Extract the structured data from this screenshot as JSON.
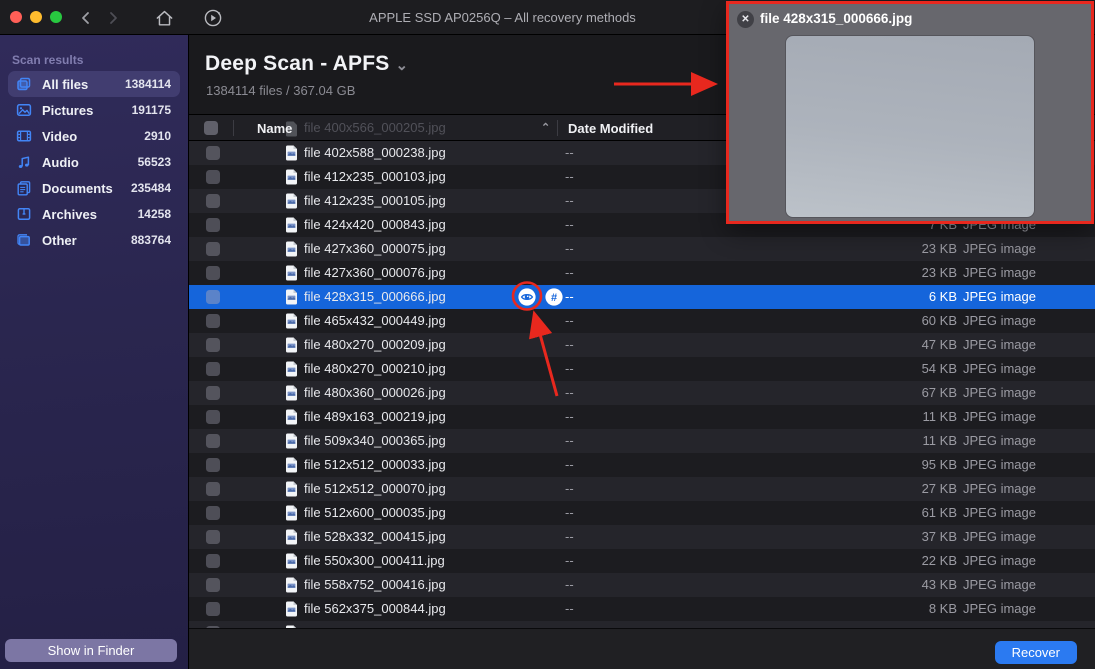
{
  "window": {
    "title": "APPLE SSD AP0256Q – All recovery methods"
  },
  "toolbar": {
    "buttons": [
      "close",
      "minimize",
      "zoom",
      "back",
      "forward",
      "home",
      "rescan"
    ]
  },
  "sidebar": {
    "section_label": "Scan results",
    "items": [
      {
        "icon": "all-files-icon",
        "label": "All files",
        "count": "1384114",
        "selected": true
      },
      {
        "icon": "pictures-icon",
        "label": "Pictures",
        "count": "191175",
        "selected": false
      },
      {
        "icon": "video-icon",
        "label": "Video",
        "count": "2910",
        "selected": false
      },
      {
        "icon": "audio-icon",
        "label": "Audio",
        "count": "56523",
        "selected": false
      },
      {
        "icon": "documents-icon",
        "label": "Documents",
        "count": "235484",
        "selected": false
      },
      {
        "icon": "archives-icon",
        "label": "Archives",
        "count": "14258",
        "selected": false
      },
      {
        "icon": "other-icon",
        "label": "Other",
        "count": "883764",
        "selected": false
      }
    ],
    "show_in_finder_label": "Show in Finder"
  },
  "header": {
    "title": "Deep Scan - APFS",
    "chevron": "⌄",
    "subtitle": "1384114 files / 367.04 GB"
  },
  "table": {
    "columns": {
      "name": "Name",
      "date_modified": "Date Modified",
      "sort_indicator": "⌃"
    },
    "ghost_row": {
      "name": "file 400x566_000205.jpg"
    },
    "clipped_row": true,
    "rows": [
      {
        "name": "file 402x588_000238.jpg",
        "date": "--",
        "size": "",
        "type": "",
        "selected": false
      },
      {
        "name": "file 412x235_000103.jpg",
        "date": "--",
        "size": "",
        "type": "",
        "selected": false
      },
      {
        "name": "file 412x235_000105.jpg",
        "date": "--",
        "size": "",
        "type": "",
        "selected": false
      },
      {
        "name": "file 424x420_000843.jpg",
        "date": "--",
        "size": "7 KB",
        "type": "JPEG image",
        "selected": false
      },
      {
        "name": "file 427x360_000075.jpg",
        "date": "--",
        "size": "23 KB",
        "type": "JPEG image",
        "selected": false
      },
      {
        "name": "file 427x360_000076.jpg",
        "date": "--",
        "size": "23 KB",
        "type": "JPEG image",
        "selected": false
      },
      {
        "name": "file 428x315_000666.jpg",
        "date": "--",
        "size": "6 KB",
        "type": "JPEG image",
        "selected": true
      },
      {
        "name": "file 465x432_000449.jpg",
        "date": "--",
        "size": "60 KB",
        "type": "JPEG image",
        "selected": false
      },
      {
        "name": "file 480x270_000209.jpg",
        "date": "--",
        "size": "47 KB",
        "type": "JPEG image",
        "selected": false
      },
      {
        "name": "file 480x270_000210.jpg",
        "date": "--",
        "size": "54 KB",
        "type": "JPEG image",
        "selected": false
      },
      {
        "name": "file 480x360_000026.jpg",
        "date": "--",
        "size": "67 KB",
        "type": "JPEG image",
        "selected": false
      },
      {
        "name": "file 489x163_000219.jpg",
        "date": "--",
        "size": "11 KB",
        "type": "JPEG image",
        "selected": false
      },
      {
        "name": "file 509x340_000365.jpg",
        "date": "--",
        "size": "11 KB",
        "type": "JPEG image",
        "selected": false
      },
      {
        "name": "file 512x512_000033.jpg",
        "date": "--",
        "size": "95 KB",
        "type": "JPEG image",
        "selected": false
      },
      {
        "name": "file 512x512_000070.jpg",
        "date": "--",
        "size": "27 KB",
        "type": "JPEG image",
        "selected": false
      },
      {
        "name": "file 512x600_000035.jpg",
        "date": "--",
        "size": "61 KB",
        "type": "JPEG image",
        "selected": false
      },
      {
        "name": "file 528x332_000415.jpg",
        "date": "--",
        "size": "37 KB",
        "type": "JPEG image",
        "selected": false
      },
      {
        "name": "file 550x300_000411.jpg",
        "date": "--",
        "size": "22 KB",
        "type": "JPEG image",
        "selected": false
      },
      {
        "name": "file 558x752_000416.jpg",
        "date": "--",
        "size": "43 KB",
        "type": "JPEG image",
        "selected": false
      },
      {
        "name": "file 562x375_000844.jpg",
        "date": "--",
        "size": "8 KB",
        "type": "JPEG image",
        "selected": false
      }
    ],
    "row_actions": {
      "hash_glyph": "#"
    }
  },
  "preview": {
    "title": "file 428x315_000666.jpg",
    "close_glyph": "✕"
  },
  "footer": {
    "recover_label": "Recover"
  },
  "colors": {
    "selection_blue": "#1565db",
    "accent_blue": "#2b7af1",
    "sidebar_icon_blue": "#4285f6",
    "annotation_red": "#e8281e",
    "traffic_red": "#ff5f57",
    "traffic_yellow": "#febc2e",
    "traffic_green": "#28c840"
  }
}
